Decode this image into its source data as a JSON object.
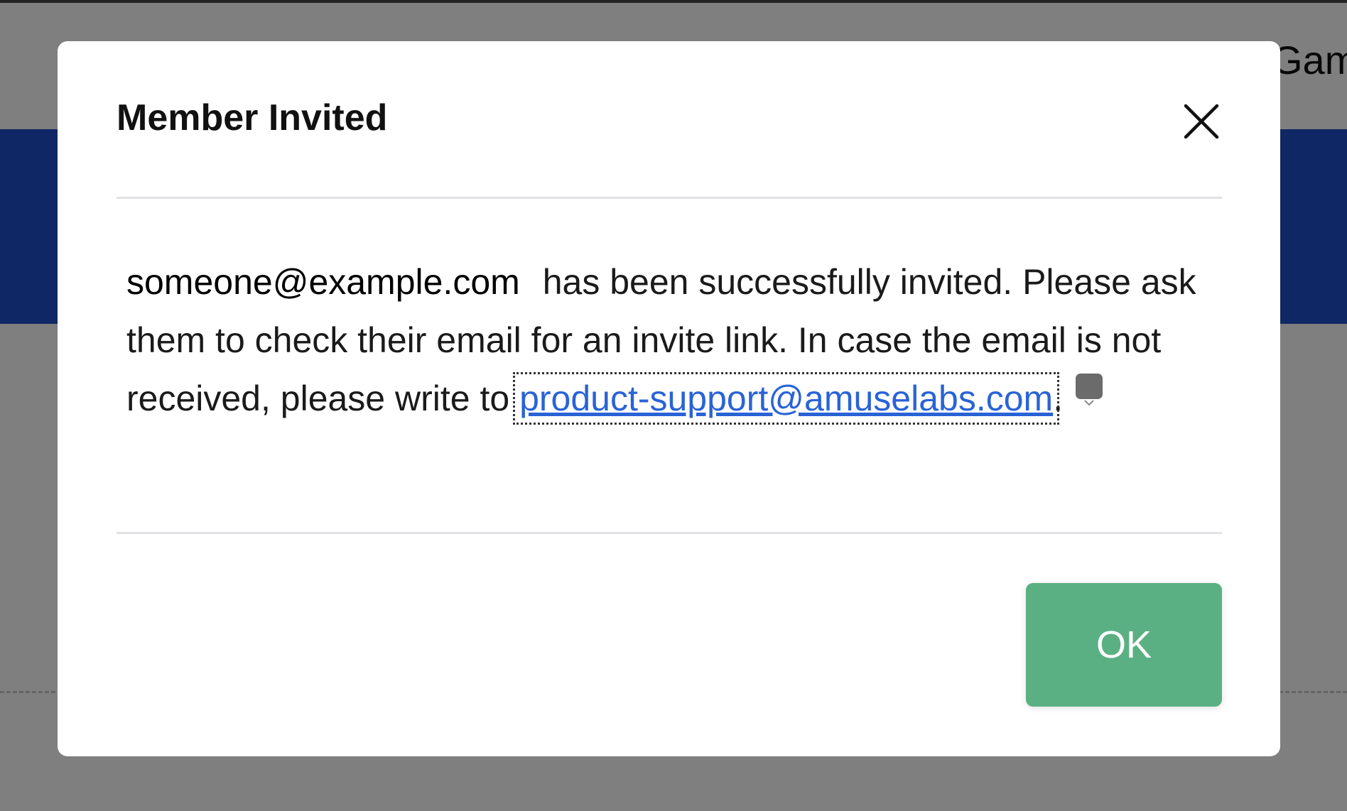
{
  "background": {
    "header_partial_text": "Gam"
  },
  "modal": {
    "title": "Member Invited",
    "close_icon": "close-icon",
    "body": {
      "email": "someone@example.com",
      "message_1": "has been successfully invited. Please ask them to check their email for an invite link. In case the email is not received, please write to",
      "support_email": "product-support@amuselabs.com",
      "trailing": ".",
      "trailing_icon": "chevron-down-icon"
    },
    "ok_label": "OK"
  },
  "colors": {
    "overlay": "#808080",
    "banner": "#1f4fc9",
    "link": "#2a63d6",
    "ok_button": "#5bb083"
  }
}
